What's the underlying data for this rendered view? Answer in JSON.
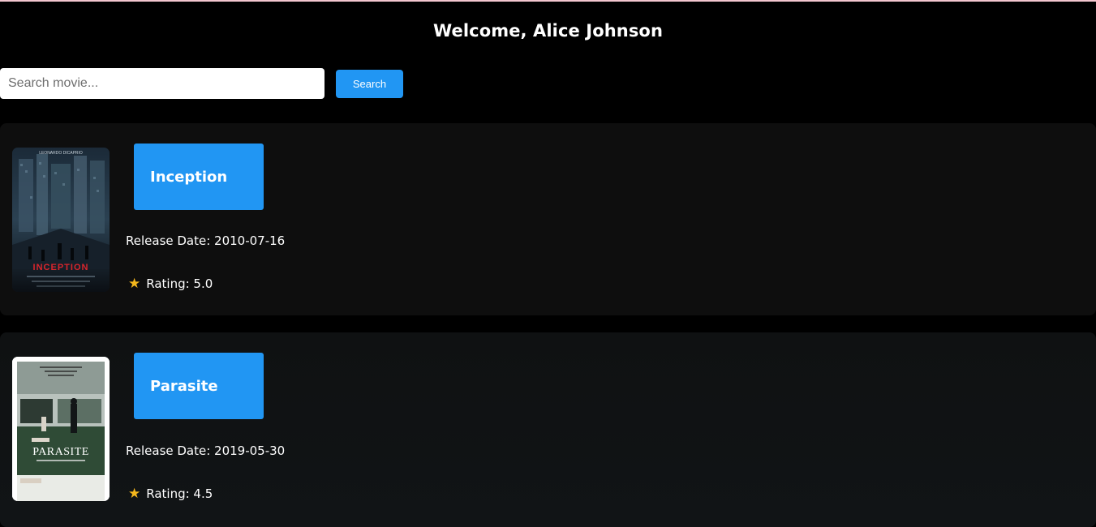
{
  "header": {
    "title": "Welcome, Alice Johnson"
  },
  "search": {
    "placeholder": "Search movie...",
    "value": "",
    "button_label": "Search"
  },
  "movies": [
    {
      "title": "Inception",
      "release_label": "Release Date: 2010-07-16",
      "rating_label": "Rating: 5.0",
      "poster_text": "INCEPTION",
      "poster_top_text": "LEONARDO DICAPRIO"
    },
    {
      "title": "Parasite",
      "release_label": "Release Date: 2019-05-30",
      "rating_label": "Rating: 4.5",
      "poster_text": "PARASITE"
    }
  ],
  "icons": {
    "rating": "star-icon"
  },
  "colors": {
    "background": "#000000",
    "card": "#0e0e0e",
    "accent": "#2196f3",
    "star": "#f5b81c",
    "top_strip": "#f3c6cf"
  }
}
